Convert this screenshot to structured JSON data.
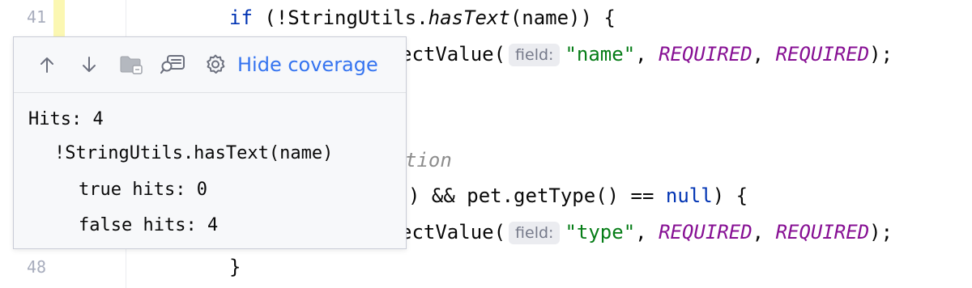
{
  "editor": {
    "line_numbers": {
      "top": "41",
      "bottom": "48"
    },
    "lines": {
      "l1": {
        "kw": "if",
        "rest_a": " (!StringUtils.",
        "method": "hasText",
        "rest_b": "(name)) {"
      },
      "l2": {
        "prefix": "ectValue(",
        "hint": "field:",
        "str": "\"name\"",
        "sep1": ", ",
        "c1": "REQUIRED",
        "sep2": ", ",
        "c2": "REQUIRED",
        "end": ");"
      },
      "l3": {
        "comment": "tion"
      },
      "l4": {
        "a": ") && pet.getType() == ",
        "kw": "null",
        "b": ") {"
      },
      "l5": {
        "prefix": "ectValue(",
        "hint": "field:",
        "str": "\"type\"",
        "sep1": ", ",
        "c1": "REQUIRED",
        "sep2": ", ",
        "c2": "REQUIRED",
        "end": ");"
      },
      "l6": {
        "brace": "}"
      }
    }
  },
  "popup": {
    "toolbar": {
      "up_icon": "arrow-up-icon",
      "down_icon": "arrow-down-icon",
      "folder_icon": "folder-icon",
      "find_icon": "find-in-file-icon",
      "settings_icon": "gear-icon",
      "hide_coverage_label": "Hide coverage",
      "link_color": "#3574f0"
    },
    "body": {
      "hits": "Hits: 4",
      "condition": "!StringUtils.hasText(name)",
      "true_hits": "true hits: 0",
      "false_hits": "false hits: 4"
    }
  },
  "colors": {
    "keyword": "#0033b3",
    "string": "#067d17",
    "constant": "#871094",
    "comment": "#8c8c8c",
    "coverage_mark": "#fbf7b2"
  }
}
